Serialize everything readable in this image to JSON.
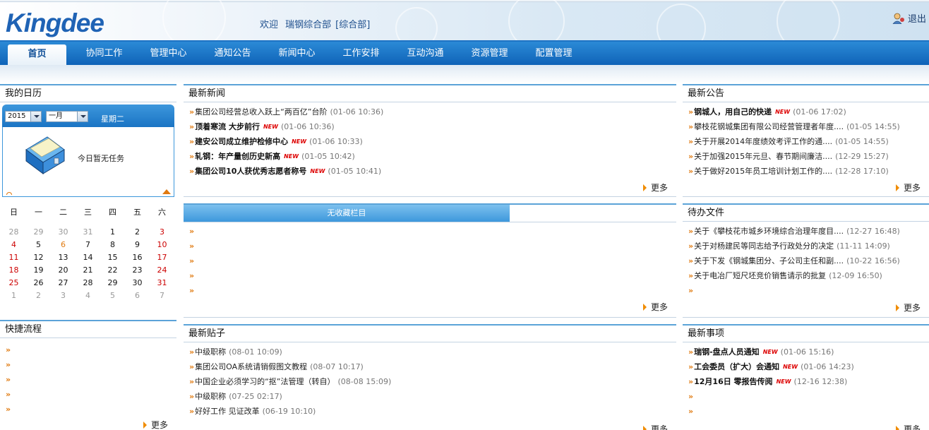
{
  "header": {
    "logo": "Kingdee",
    "welcome_word": "欢迎",
    "user_name": "瑞钢综合部",
    "dept": "[综合部]",
    "logout": "退出"
  },
  "nav": {
    "tabs": [
      "首页",
      "协同工作",
      "管理中心",
      "通知公告",
      "新闻中心",
      "工作安排",
      "互动沟通",
      "资源管理",
      "配置管理"
    ],
    "active": 0
  },
  "calendar": {
    "title": "我的日历",
    "year": "2015",
    "month": "一月",
    "weekday": "星期二",
    "no_task": "今日暂无任务",
    "weekday_headers": [
      "日",
      "一",
      "二",
      "三",
      "四",
      "五",
      "六"
    ],
    "rows": [
      [
        "28",
        "29",
        "30",
        "31",
        "1",
        "2",
        "3"
      ],
      [
        "4",
        "5",
        "6",
        "7",
        "8",
        "9",
        "10"
      ],
      [
        "11",
        "12",
        "13",
        "14",
        "15",
        "16",
        "17"
      ],
      [
        "18",
        "19",
        "20",
        "21",
        "22",
        "23",
        "24"
      ],
      [
        "25",
        "26",
        "27",
        "28",
        "29",
        "30",
        "31"
      ],
      [
        "1",
        "2",
        "3",
        "4",
        "5",
        "6",
        "7"
      ]
    ]
  },
  "quick_flow": {
    "title": "快捷流程",
    "more": "更多",
    "empty_rows": 5
  },
  "news": {
    "title": "最新新闻",
    "more": "更多",
    "items": [
      {
        "title": "集团公司经营总收入跃上“两百亿”台阶",
        "date": "(01-06 10:36)",
        "bold": false,
        "new": false
      },
      {
        "title": "顶着寒流 大步前行",
        "date": "(01-06 10:36)",
        "bold": true,
        "new": true
      },
      {
        "title": "建安公司成立维护检修中心",
        "date": "(01-06 10:33)",
        "bold": true,
        "new": true
      },
      {
        "title": "轧钢：年产量创历史新高",
        "date": "(01-05 10:42)",
        "bold": true,
        "new": true
      },
      {
        "title": "集团公司10人获优秀志愿者称号",
        "date": "(01-05 10:41)",
        "bold": true,
        "new": true
      }
    ]
  },
  "favorites": {
    "tab": "无收藏栏目",
    "more": "更多",
    "empty_rows": 5
  },
  "posts": {
    "title": "最新贴子",
    "more": "更多",
    "items": [
      {
        "title": "中级职称",
        "date": "(08-01 10:09)"
      },
      {
        "title": "集团公司OA系统请销假图文教程",
        "date": "(08-07 10:17)"
      },
      {
        "title": "中国企业必须学习的“抠”法管理（转自）",
        "date": "(08-08 15:09)"
      },
      {
        "title": "中级职称",
        "date": "(07-25 02:17)"
      },
      {
        "title": "好好工作 见证改革",
        "date": "(06-19 10:10)"
      }
    ]
  },
  "notices": {
    "title": "最新公告",
    "more": "更多",
    "items": [
      {
        "title": "钢城人，用自己的快递",
        "date": "(01-06 17:02)",
        "bold": true,
        "new": true
      },
      {
        "title": "攀枝花钢城集团有限公司经营管理者年度....",
        "date": "(01-05 14:55)",
        "bold": false,
        "new": false
      },
      {
        "title": "关于开展2014年度绩效考评工作的通....",
        "date": "(01-05 14:55)",
        "bold": false,
        "new": false
      },
      {
        "title": "关于加强2015年元旦、春节期间廉洁....",
        "date": "(12-29 15:27)",
        "bold": false,
        "new": false
      },
      {
        "title": "关于做好2015年员工培训计划工作的....",
        "date": "(12-28 17:10)",
        "bold": false,
        "new": false
      }
    ]
  },
  "todo": {
    "title": "待办文件",
    "more": "更多",
    "items": [
      {
        "title": "关于《攀枝花市城乡环境综合治理年度目....",
        "date": "(12-27 16:48)"
      },
      {
        "title": "关于对杨建民等同志给予行政处分的决定",
        "date": "(11-11 14:09)"
      },
      {
        "title": "关于下发《钢城集团分、子公司主任和副....",
        "date": "(10-22 16:56)"
      },
      {
        "title": "关于电冶厂短尺坯竞价销售请示的批复",
        "date": "(12-09 16:50)"
      },
      {
        "title": "",
        "date": ""
      }
    ]
  },
  "events": {
    "title": "最新事项",
    "more": "更多",
    "items": [
      {
        "title": "瑞钢-盘点人员通知",
        "date": "(01-06 15:16)",
        "bold": true,
        "new": true
      },
      {
        "title": "工会委员（扩大）会通知",
        "date": "(01-06 14:23)",
        "bold": true,
        "new": true
      },
      {
        "title": "12月16日 零报告传阅",
        "date": "(12-16 12:38)",
        "bold": true,
        "new": true
      },
      {
        "title": "",
        "date": "",
        "bold": false,
        "new": false
      },
      {
        "title": "",
        "date": "",
        "bold": false,
        "new": false
      }
    ]
  },
  "new_badge": "NEW",
  "colors": {
    "nav": "#1a74c4",
    "accent": "#e07a10",
    "new": "#dd0000"
  }
}
